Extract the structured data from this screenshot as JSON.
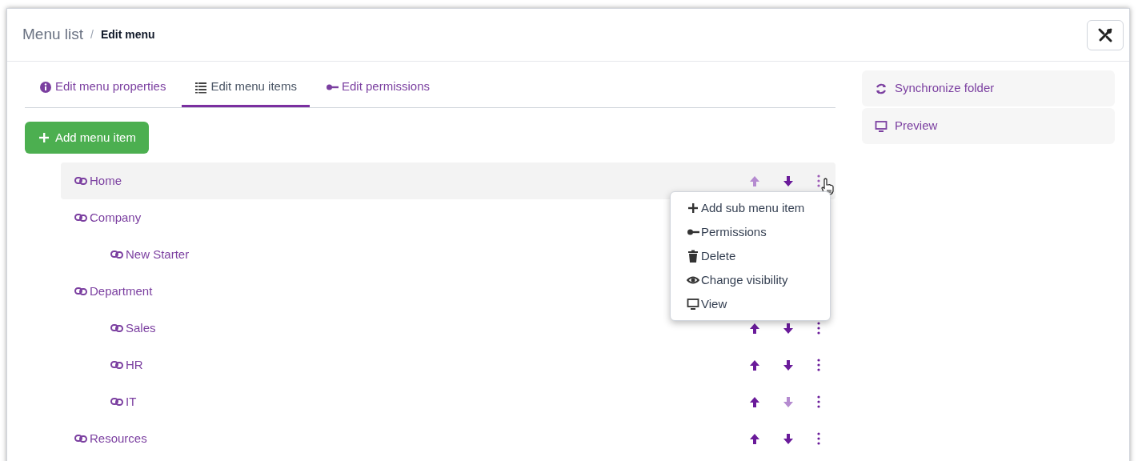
{
  "breadcrumb": [
    {
      "label": "Menu list",
      "current": false
    },
    {
      "label": "/",
      "kind": "separator"
    },
    {
      "label": "Edit menu",
      "current": true
    }
  ],
  "tabs": [
    {
      "label": "Edit menu properties",
      "kind": "info",
      "selected": false
    },
    {
      "label": "Edit menu items",
      "kind": "list",
      "selected": true
    },
    {
      "label": "Edit permissions",
      "kind": "key",
      "selected": false
    }
  ],
  "add_button": {
    "label": "Add menu item"
  },
  "menu_items": [
    {
      "label": "Home",
      "hovered": true,
      "actions": {
        "up_disabled": true,
        "down_disabled": false
      }
    },
    {
      "label": "Company",
      "hovered": false,
      "children": [
        {
          "label": "New Starter",
          "hovered": false
        }
      ]
    },
    {
      "label": "Department",
      "hovered": false,
      "children": [
        {
          "label": "Sales",
          "hovered": false,
          "actions": {
            "up_disabled": false,
            "down_disabled": false
          }
        },
        {
          "label": "HR",
          "hovered": false,
          "actions": {
            "up_disabled": false,
            "down_disabled": false
          }
        },
        {
          "label": "IT",
          "hovered": false,
          "actions": {
            "up_disabled": false,
            "down_disabled": true
          }
        }
      ]
    },
    {
      "label": "Resources",
      "hovered": false,
      "actions": {
        "up_disabled": false,
        "down_disabled": false
      }
    }
  ],
  "context_menu": [
    {
      "label": "Add sub menu item",
      "kind": "plus"
    },
    {
      "label": "Permissions",
      "kind": "key"
    },
    {
      "label": "Delete",
      "kind": "trash"
    },
    {
      "label": "Change visibility",
      "kind": "eye"
    },
    {
      "label": "View",
      "kind": "monitor"
    }
  ],
  "side_actions": [
    {
      "label": "Synchronize folder",
      "kind": "sync"
    },
    {
      "label": "Preview",
      "kind": "monitor"
    }
  ]
}
